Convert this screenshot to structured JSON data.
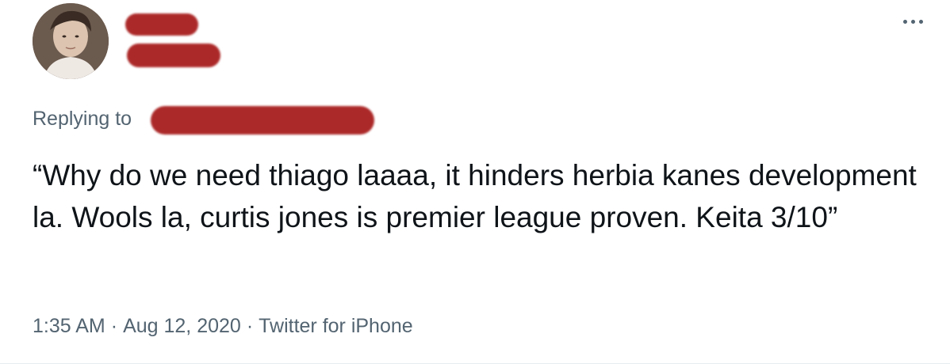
{
  "tweet": {
    "replying_label": "Replying to",
    "text": "“Why do we need thiago laaaa, it hinders herbia kanes development la. Wools la, curtis jones is premier league proven. Keita 3/10”",
    "time": "1:35 AM",
    "separator": "·",
    "date": "Aug 12, 2020",
    "source": "Twitter for iPhone"
  },
  "icons": {
    "more": "more-horizontal-icon"
  },
  "colors": {
    "redaction": "#a81e1e",
    "text_primary": "#0f1419",
    "text_secondary": "#536471"
  }
}
